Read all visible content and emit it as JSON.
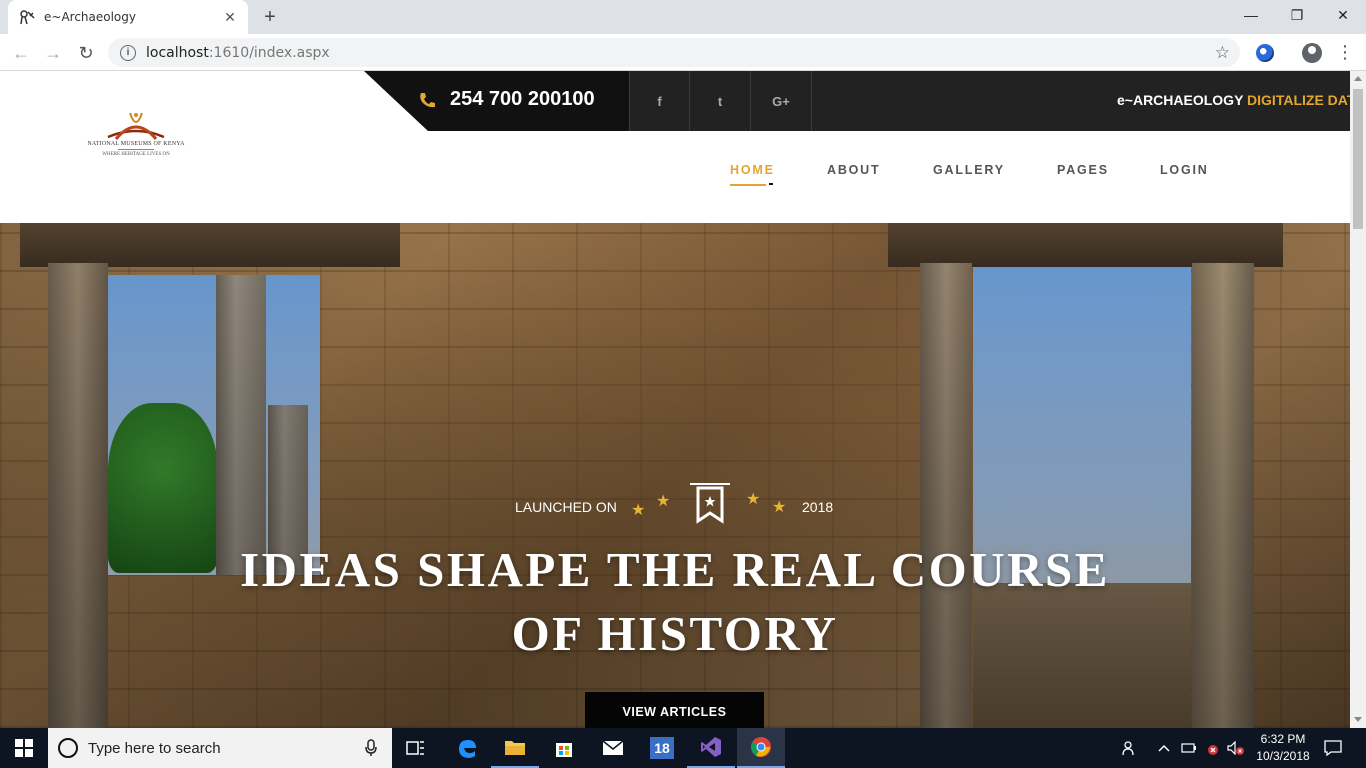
{
  "browser": {
    "tab_title": "e~Archaeology",
    "tab_close": "✕",
    "new_tab": "+",
    "url_host": "localhost",
    "url_rest": ":1610/index.aspx",
    "window_controls": {
      "minimize": "—",
      "maximize": "❐",
      "close": "✕"
    },
    "nav": {
      "back": "←",
      "forward": "→",
      "reload": "↻"
    },
    "bookmark_star": "☆",
    "menu": "⋮"
  },
  "header": {
    "logo_line1": "NATIONAL MUSEUMS OF KENYA",
    "logo_line2": "WHERE HERITAGE LIVES ON",
    "phone": "254 700 200100",
    "social": [
      "f",
      "t",
      "G+"
    ],
    "tagline_white": "e~ARCHAEOLOGY ",
    "tagline_gold": "DIGITALIZE DATABASE COLLECTION",
    "accent_color": "#e3a72f",
    "nav": [
      {
        "label": "HOME",
        "active": true
      },
      {
        "label": "ABOUT"
      },
      {
        "label": "GALLERY"
      },
      {
        "label": "PAGES"
      },
      {
        "label": "LOGIN"
      }
    ]
  },
  "hero": {
    "launched_label": "LAUNCHED ON",
    "launched_year": "2018",
    "title_line1": "IDEAS SHAPE THE REAL COURSE",
    "title_line2": "OF HISTORY",
    "button": "VIEW ARTICLES"
  },
  "taskbar": {
    "search_placeholder": "Type here to search",
    "calendar_badge": "18",
    "time": "6:32 PM",
    "date": "10/3/2018"
  }
}
